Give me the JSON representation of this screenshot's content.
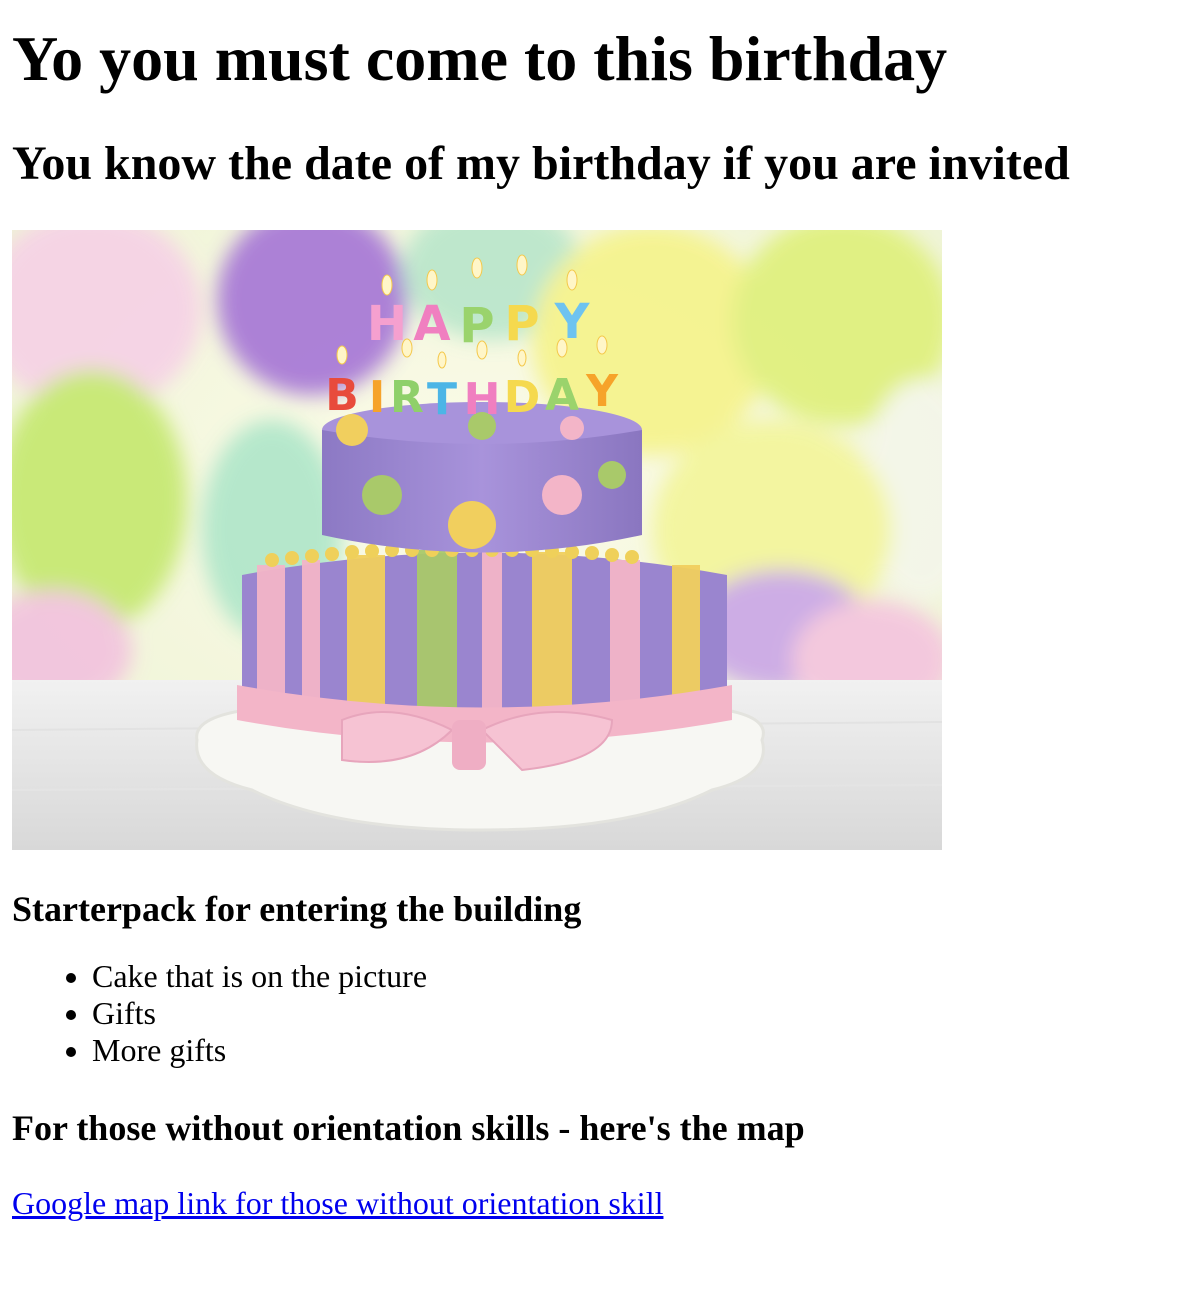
{
  "page": {
    "title": "Yo you must come to this birthday",
    "subtitle": "You know the date of my birthday if you are invited"
  },
  "image": {
    "alt": "Happy Birthday cake",
    "candle_letters_top": [
      "H",
      "A",
      "P",
      "P",
      "Y"
    ],
    "candle_letters_bottom": [
      "B",
      "I",
      "R",
      "T",
      "H",
      "D",
      "A",
      "Y"
    ]
  },
  "starterpack": {
    "heading": "Starterpack for entering the building",
    "items": [
      "Cake that is on the picture",
      "Gifts",
      "More gifts"
    ]
  },
  "map": {
    "heading": "For those without orientation skills - here's the map",
    "link_text": "Google map link for those without orientation skill"
  },
  "colors": {
    "link": "#0000ee",
    "cake_purple": "#9a85cf",
    "ribbon_pink": "#f3b5c8",
    "stripe_yellow": "#f1cf5e",
    "stripe_green": "#a9c96a"
  }
}
